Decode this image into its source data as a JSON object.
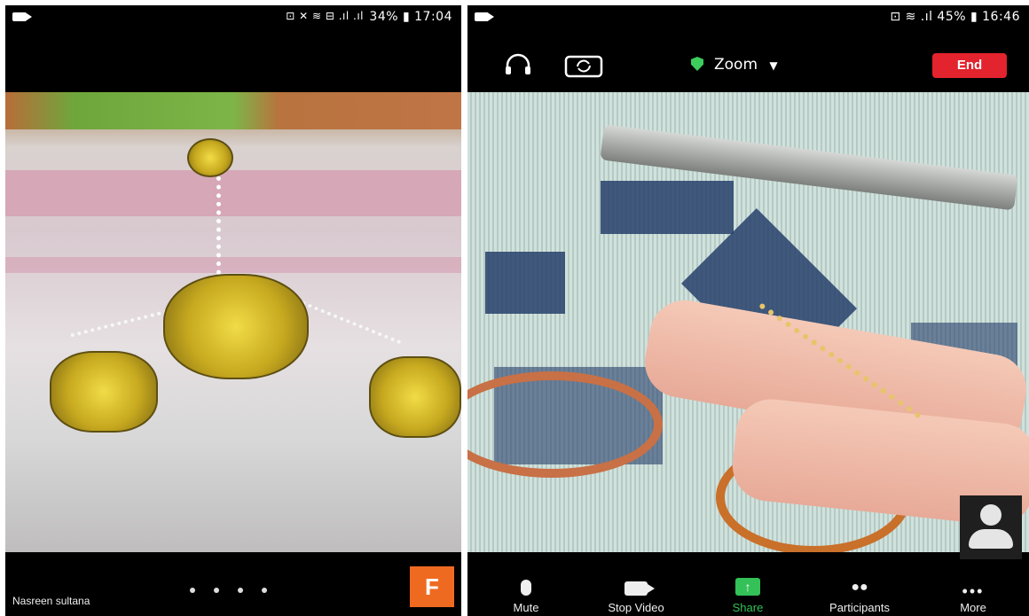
{
  "left_phone": {
    "status_time": "34% ▮ 17:04",
    "status_icons": "⊡ ✕ ≋ ⊟ .ıl .ıl",
    "participant_name": "Nasreen sultana",
    "tile_letter": "F"
  },
  "right_phone": {
    "status_right": "⊡ ≋ .ıl 45% ▮ 16:46",
    "meeting_title": "Zoom",
    "end_label": "End",
    "toolbar": {
      "mute": "Mute",
      "stop_video": "Stop Video",
      "share": "Share",
      "participants": "Participants",
      "more": "More"
    }
  },
  "icons": [
    "video-camera-icon",
    "headphones-icon",
    "switch-camera-icon",
    "shield-icon",
    "chevron-down-icon",
    "microphone-icon",
    "video-icon",
    "share-arrow-icon",
    "participants-icon",
    "more-dots-icon",
    "avatar-icon"
  ],
  "colors": {
    "end": "#e3232d",
    "share": "#33c158",
    "tile": "#ef6a21",
    "shield": "#3ccd5d"
  }
}
